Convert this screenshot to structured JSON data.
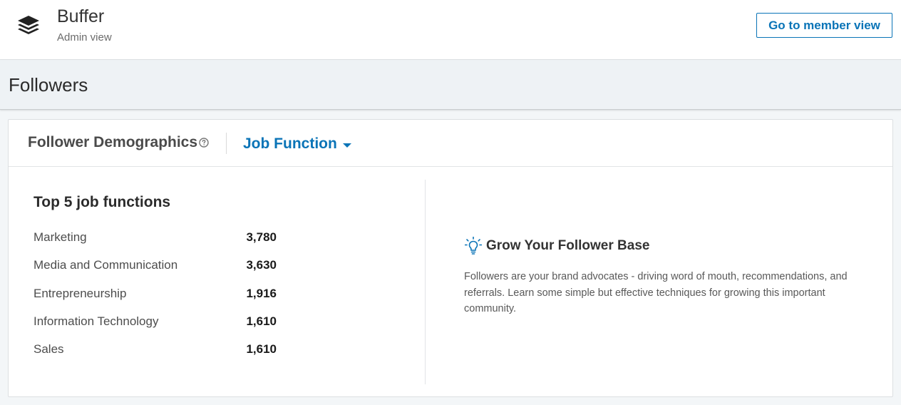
{
  "topbar": {
    "logo_icon": "buffer-stack-icon",
    "org_name": "Buffer",
    "org_sub": "Admin view",
    "member_button": "Go to member view"
  },
  "page": {
    "title": "Followers"
  },
  "demographics": {
    "title": "Follower Demographics",
    "help_icon": "question-circle-icon",
    "dropdown_label": "Job Function",
    "dropdown_icon": "caret-down-icon",
    "list_title": "Top 5 job functions",
    "rows": [
      {
        "label": "Marketing",
        "count": "3,780"
      },
      {
        "label": "Media and Communication",
        "count": "3,630"
      },
      {
        "label": "Entrepreneurship",
        "count": "1,916"
      },
      {
        "label": "Information Technology",
        "count": "1,610"
      },
      {
        "label": "Sales",
        "count": "1,610"
      }
    ]
  },
  "tip": {
    "icon": "lightbulb-icon",
    "title": "Grow Your Follower Base",
    "body": "Followers are your brand advocates - driving word of mouth, recommendations, and referrals. Learn some simple but effective techniques for growing this important community."
  },
  "colors": {
    "accent": "#0a74b7",
    "header_bg": "#eef2f5",
    "page_bg": "#f3f6f8"
  }
}
